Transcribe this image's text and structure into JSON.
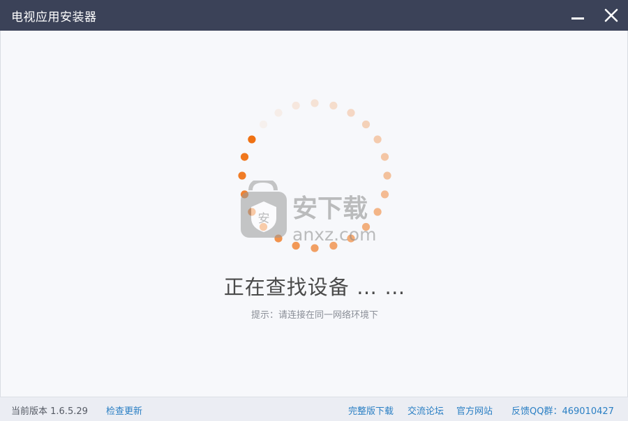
{
  "window": {
    "title": "电视应用安装器"
  },
  "main": {
    "status": "正在查找设备 …  …",
    "hint": "提示：请连接在同一网络环境下"
  },
  "watermark": {
    "brand_cn": "安下载",
    "brand_url": "anxz.com",
    "badge_char": "安"
  },
  "footer": {
    "version_label": "当前版本 1.6.5.29",
    "check_update": "检查更新",
    "full_download": "完整版下载",
    "forum": "交流论坛",
    "website": "官方网站",
    "feedback": "反馈QQ群：469010427"
  },
  "colors": {
    "titlebar": "#3b4258",
    "accent_orange": "#ef7113",
    "link": "#2a7fc4"
  },
  "icons": {
    "minimize": "minimize-icon",
    "close": "close-icon",
    "spinner": "loading-spinner-icon"
  }
}
